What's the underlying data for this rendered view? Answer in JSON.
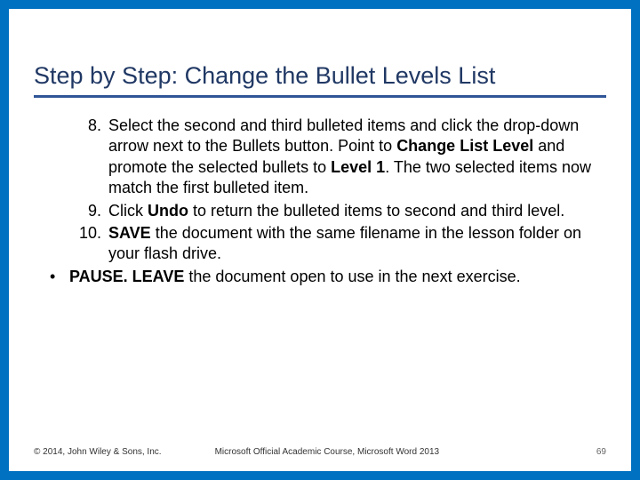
{
  "title": "Step by Step: Change the Bullet Levels List",
  "steps": [
    {
      "num": "8.",
      "segments": [
        {
          "t": "Select the second and third bulleted items and click the drop-down arrow next to the Bullets button. Point to ",
          "b": false
        },
        {
          "t": "Change List Level",
          "b": true
        },
        {
          "t": " and promote the selected bullets to ",
          "b": false
        },
        {
          "t": "Level 1",
          "b": true
        },
        {
          "t": ". The two selected items now match the first bulleted item.",
          "b": false
        }
      ]
    },
    {
      "num": "9.",
      "segments": [
        {
          "t": "Click ",
          "b": false
        },
        {
          "t": "Undo",
          "b": true
        },
        {
          "t": " to return the bulleted items to second and third level.",
          "b": false
        }
      ]
    },
    {
      "num": "10.",
      "segments": [
        {
          "t": " ",
          "b": false
        },
        {
          "t": "SAVE",
          "b": true
        },
        {
          "t": " the document with the same filename in the lesson folder on your flash drive.",
          "b": false
        }
      ]
    }
  ],
  "pause": [
    {
      "t": "PAUSE. LEAVE",
      "b": true
    },
    {
      "t": " the document open to use in the next exercise.",
      "b": false
    }
  ],
  "footer": {
    "copyright": "© 2014, John Wiley & Sons, Inc.",
    "course": "Microsoft Official Academic Course, Microsoft Word 2013",
    "page": "69"
  }
}
